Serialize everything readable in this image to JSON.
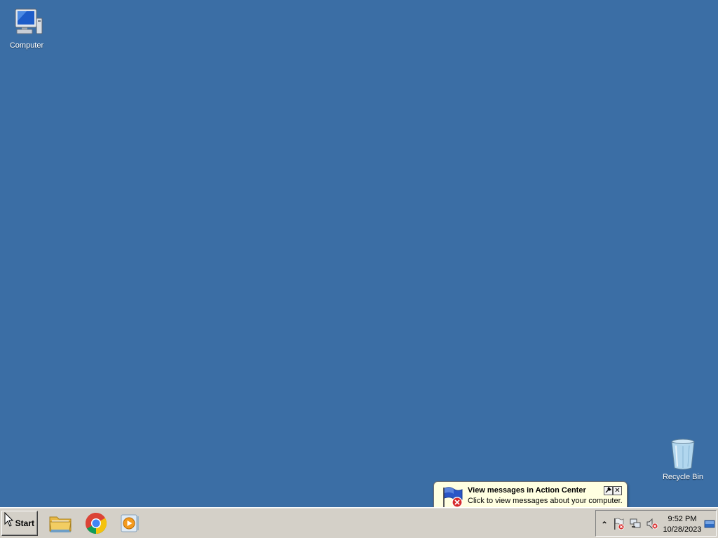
{
  "desktop": {
    "icons": [
      {
        "label": "Computer",
        "icon": "computer-icon"
      },
      {
        "label": "Recycle Bin",
        "icon": "recycle-bin-icon"
      }
    ]
  },
  "notification": {
    "title": "View messages in Action Center",
    "text": "Click to view messages about your computer.",
    "icon": "action-center-flag-icon",
    "options_icon": "options-icon",
    "close_glyph": "✕"
  },
  "taskbar": {
    "start_label": "Start",
    "pinned": [
      {
        "name": "Windows Explorer",
        "icon": "folder-icon"
      },
      {
        "name": "Google Chrome",
        "icon": "chrome-icon"
      },
      {
        "name": "Windows Media Player",
        "icon": "media-player-icon"
      }
    ],
    "tray": {
      "chevron_glyph": "⌃",
      "time": "9:52 PM",
      "date": "10/28/2023"
    }
  },
  "colors": {
    "desktop_background": "#3b6ea5",
    "taskbar": "#d4d0c8",
    "balloon": "#ffffe1"
  }
}
